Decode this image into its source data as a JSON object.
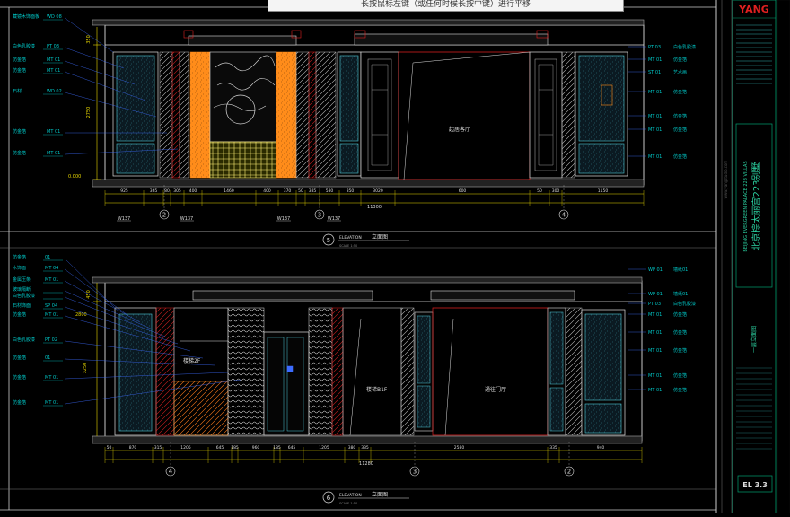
{
  "hint": "长按鼠标左键（或任何时候长按中键）进行平移",
  "title_block": {
    "brand": "YANG",
    "project_cn": "北京棕太丽宫223别墅",
    "project_en": "BEIJING EVERGREEN PALACE 223 VILLAS",
    "sheet_name": "一层立面图",
    "sheet_number": "EL 3.3",
    "web": "www.yangstudio.com"
  },
  "top_elevation": {
    "number": "5",
    "label_en": "ELEVATION",
    "label_cn": "立面图",
    "scale": "SCALE  1:50",
    "total_width": "11300",
    "heights": [
      "350",
      "2750",
      "0.000"
    ],
    "room_label": "起居客厅",
    "left_tags": [
      {
        "text": "藏镜木饰面板",
        "code": "WD 08"
      },
      {
        "text": "白色乳胶漆",
        "code": "PT 03"
      },
      {
        "text": "仿金箔",
        "code": "MT 01"
      },
      {
        "text": "仿金箔",
        "code": "MT 01"
      },
      {
        "text": "石材",
        "code": "WD 02"
      },
      {
        "text": "仿金箔",
        "code": "MT 01"
      },
      {
        "text": "仿金箔",
        "code": "MT 01"
      }
    ],
    "right_tags": [
      {
        "code": "PT 03",
        "text": "白色乳胶漆"
      },
      {
        "code": "MT 01",
        "text": "仿金箔"
      },
      {
        "code": "ST 01",
        "text": "艺术画"
      },
      {
        "code": "MT 01",
        "text": "仿金箔"
      },
      {
        "code": "MT 01",
        "text": "仿金箔"
      },
      {
        "code": "MT 01",
        "text": "仿金箔"
      },
      {
        "code": "MT 01",
        "text": "仿金箔"
      }
    ],
    "dims": [
      "925",
      "365",
      "80",
      "305",
      "400",
      "1460",
      "400",
      "370",
      "50",
      "385",
      "580",
      "850",
      "3020",
      "600",
      "50",
      "300",
      "1150"
    ],
    "axes": [
      "2",
      "3",
      "4"
    ],
    "refs": [
      "W137",
      "W137",
      "W137",
      "W137"
    ]
  },
  "bottom_elevation": {
    "number": "6",
    "label_en": "ELEVATION",
    "label_cn": "立面图",
    "scale": "SCALE  1:50",
    "total_width": "11280",
    "heights": [
      "450",
      "3250",
      "2800"
    ],
    "rooms": [
      "楼梯2F",
      "楼梯B1F",
      "通往门厅"
    ],
    "left_tags": [
      {
        "text": "仿金箔",
        "code": "01"
      },
      {
        "text": "木饰面",
        "code": "MT 04"
      },
      {
        "text": "金属压条",
        "code": "MT 01"
      },
      {
        "text": "玻璃隔断",
        "code": ""
      },
      {
        "text": "白色乳胶漆",
        "code": ""
      },
      {
        "text": "石材饰面",
        "code": "SP 04"
      },
      {
        "text": "仿金箔",
        "code": "MT 01"
      },
      {
        "text": "白色乳胶漆",
        "code": "PT 02"
      },
      {
        "text": "仿金箔",
        "code": "01"
      },
      {
        "text": "仿金箔",
        "code": "MT 01"
      },
      {
        "text": "仿金箔",
        "code": "MT 01"
      }
    ],
    "right_tags": [
      {
        "code": "WP 01",
        "text": "墙纸01"
      },
      {
        "code": "WP 01",
        "text": "墙纸01"
      },
      {
        "code": "PT 03",
        "text": "白色乳胶漆"
      },
      {
        "code": "MT 01",
        "text": "仿金箔"
      },
      {
        "code": "MT 01",
        "text": "仿金箔"
      },
      {
        "code": "MT 01",
        "text": "仿金箔"
      },
      {
        "code": "MT 01",
        "text": "仿金箔"
      },
      {
        "code": "MT 01",
        "text": "仿金箔"
      }
    ],
    "dims": [
      "50",
      "870",
      "315",
      "1205",
      "645",
      "185",
      "960",
      "185",
      "645",
      "1205",
      "380",
      "335",
      "2580",
      "335",
      "940"
    ],
    "axes": [
      "4",
      "3",
      "2"
    ]
  },
  "colors": {
    "background": "#000000",
    "outline_white": "#e6e6e6",
    "dim_yellow": "#e8d800",
    "tag_cyan": "#00c8c8",
    "leader_blue": "#3c6cff",
    "wall_red": "#e02020",
    "gold_fill": "#ff8c1a",
    "screen_yellow": "#ffff80",
    "frame_green": "#00a070"
  }
}
